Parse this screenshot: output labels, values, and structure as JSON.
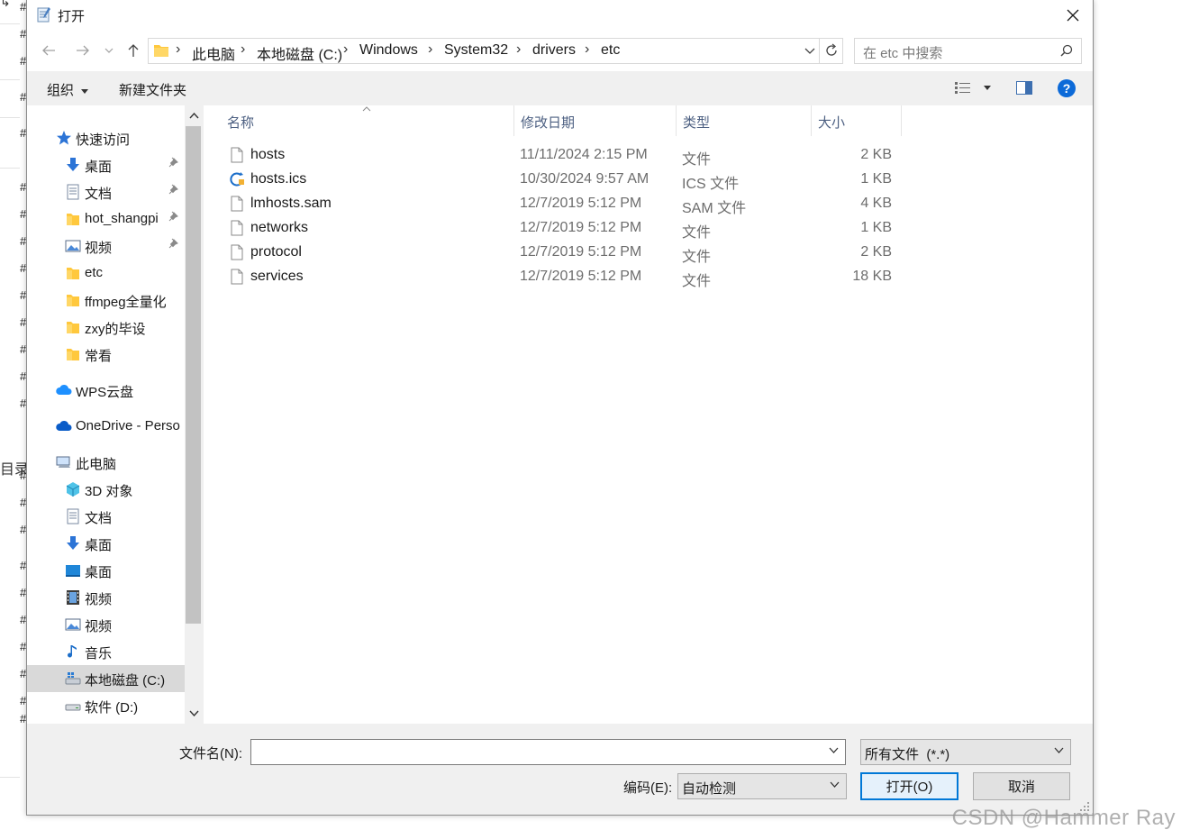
{
  "background": {
    "hash_glyph": "#",
    "side_label": "目录"
  },
  "watermark": "CSDN @Hammer Ray",
  "dialog": {
    "title": "打开",
    "breadcrumb": [
      "此电脑",
      "本地磁盘 (C:)",
      "Windows",
      "System32",
      "drivers",
      "etc"
    ],
    "search_placeholder": "在 etc 中搜索",
    "toolbar": {
      "organize": "组织",
      "new_folder": "新建文件夹"
    },
    "nav": {
      "quick_access": "快速访问",
      "items": [
        {
          "label": "桌面",
          "icon": "download-arrow-icon",
          "pinned": true
        },
        {
          "label": "文档",
          "icon": "document-icon",
          "pinned": true
        },
        {
          "label": "hot_shangpi",
          "icon": "folder-icon",
          "pinned": true
        },
        {
          "label": "视频",
          "icon": "picture-icon",
          "pinned": true
        },
        {
          "label": "etc",
          "icon": "folder-icon",
          "pinned": false
        },
        {
          "label": "ffmpeg全量化",
          "icon": "folder-icon",
          "pinned": false
        },
        {
          "label": "zxy的毕设",
          "icon": "folder-icon",
          "pinned": false
        },
        {
          "label": "常看",
          "icon": "folder-icon",
          "pinned": false
        }
      ],
      "wps": "WPS云盘",
      "onedrive": "OneDrive - Perso",
      "this_pc": "此电脑",
      "pc_items": [
        {
          "label": "3D 对象",
          "icon": "cube-icon"
        },
        {
          "label": "文档",
          "icon": "document-icon"
        },
        {
          "label": "桌面",
          "icon": "download-arrow-icon"
        },
        {
          "label": "桌面",
          "icon": "desktop-icon"
        },
        {
          "label": "视频",
          "icon": "film-icon"
        },
        {
          "label": "视频",
          "icon": "picture-icon"
        },
        {
          "label": "音乐",
          "icon": "music-note-icon"
        },
        {
          "label": "本地磁盘 (C:)",
          "icon": "windows-drive-icon",
          "selected": true
        },
        {
          "label": "软件 (D:)",
          "icon": "drive-icon"
        }
      ]
    },
    "columns": {
      "name": "名称",
      "date": "修改日期",
      "type": "类型",
      "size": "大小"
    },
    "files": [
      {
        "name": "hosts",
        "date": "11/11/2024 2:15 PM",
        "type": "文件",
        "size": "2 KB",
        "icon": "file-icon"
      },
      {
        "name": "hosts.ics",
        "date": "10/30/2024 9:57 AM",
        "type": "ICS 文件",
        "size": "1 KB",
        "icon": "calendar-sync-icon"
      },
      {
        "name": "lmhosts.sam",
        "date": "12/7/2019 5:12 PM",
        "type": "SAM 文件",
        "size": "4 KB",
        "icon": "file-icon"
      },
      {
        "name": "networks",
        "date": "12/7/2019 5:12 PM",
        "type": "文件",
        "size": "1 KB",
        "icon": "file-icon"
      },
      {
        "name": "protocol",
        "date": "12/7/2019 5:12 PM",
        "type": "文件",
        "size": "2 KB",
        "icon": "file-icon"
      },
      {
        "name": "services",
        "date": "12/7/2019 5:12 PM",
        "type": "文件",
        "size": "18 KB",
        "icon": "file-icon"
      }
    ],
    "bottom": {
      "filename_label": "文件名(N):",
      "filename_value": "",
      "filter": "所有文件  (*.*)",
      "encoding_label": "编码(E):",
      "encoding_value": "自动检测",
      "open": "打开(O)",
      "cancel": "取消"
    },
    "colors": {
      "accent": "#0078d7",
      "selection": "#d9d9d9",
      "header_text": "#4d6082",
      "folder": "#ffc83d"
    }
  }
}
